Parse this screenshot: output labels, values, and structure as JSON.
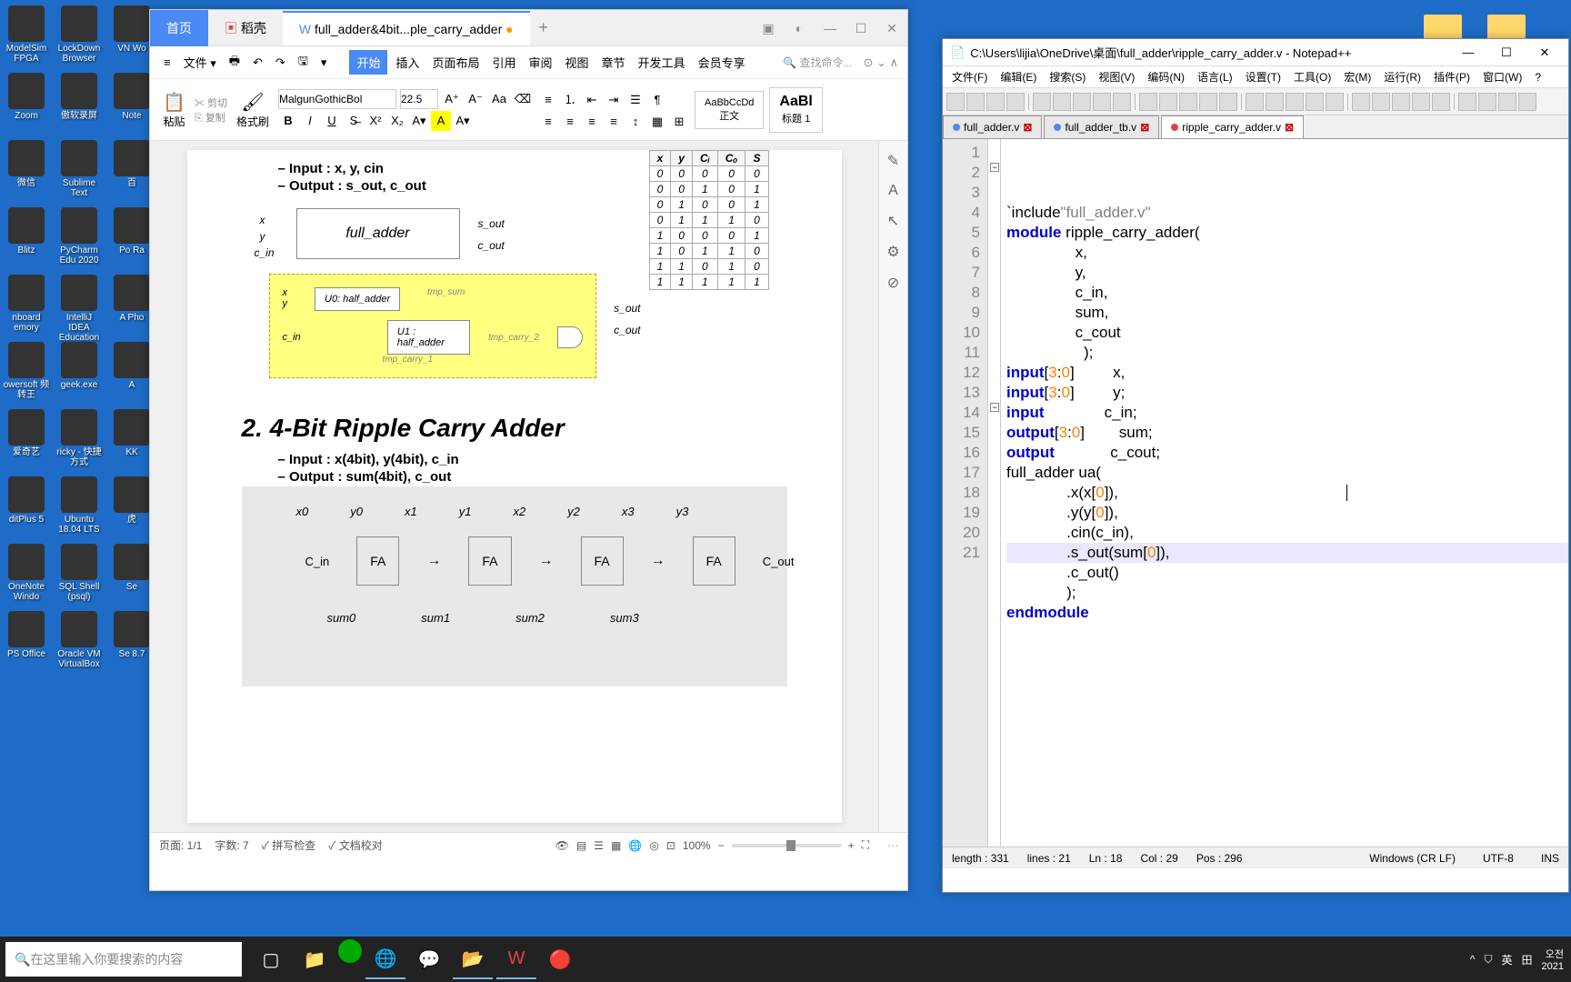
{
  "desktop_icons": [
    [
      "ModelSim FPGA",
      "LockDown Browser",
      "VN Wo"
    ],
    [
      "Zoom",
      "傲软录屏",
      "Note"
    ],
    [
      "微信",
      "Sublime Text",
      "百"
    ],
    [
      "Blitz",
      "PyCharm Edu 2020",
      "Po Ra"
    ],
    [
      "nboard emory",
      "IntelliJ IDEA Education",
      "A Pho"
    ],
    [
      "owersoft 频转王",
      "geek.exe",
      "A"
    ],
    [
      "爱奇艺",
      "ricky - 快捷方式",
      "KK"
    ],
    [
      "ditPlus 5",
      "Ubuntu 18.04 LTS",
      "虎"
    ],
    [
      "OneNote Windo",
      "SQL Shell (psql)",
      "Se"
    ],
    [
      "PS Office",
      "Oracle VM VirtualBox",
      "Se 8.7"
    ]
  ],
  "wps": {
    "tabs": {
      "home": "首页",
      "shell": "稻壳",
      "doc": "full_adder&4bit...ple_carry_adder"
    },
    "menu": [
      "三",
      "文件",
      "▢",
      "↶",
      "↷",
      "⎙",
      "⌄",
      "▾"
    ],
    "menubar": [
      "开始",
      "插入",
      "页面布局",
      "引用",
      "审阅",
      "视图",
      "章节",
      "开发工具",
      "会员专享"
    ],
    "search_ph": "查找命令...",
    "ribbon": {
      "paste": "粘贴",
      "cut": "剪切",
      "copy": "复制",
      "fmt": "格式刷",
      "font": "MalgunGothicBol",
      "size": "22.5",
      "style1": "AaBbCcDd",
      "style1_name": "正文",
      "style2": "AaBl",
      "style2_name": "标题 1"
    },
    "doc": {
      "bullets1": [
        "Input : x, y, cin",
        "Output : s_out, c_out"
      ],
      "fa_block": "full_adder",
      "sig_in": [
        "x",
        "y",
        "c_in"
      ],
      "sig_out": [
        "s_out",
        "c_out"
      ],
      "ha": [
        "U0:\nhalf_adder",
        "U1 :\nhalf_adder"
      ],
      "ha_nets": [
        "tmp_sum",
        "tmp_carry_2",
        "tmp_carry_1"
      ],
      "truth_hdr": [
        "x",
        "y",
        "Cᵢ",
        "Cₒ",
        "S"
      ],
      "truth_rows": [
        [
          "0",
          "0",
          "0",
          "0",
          "0"
        ],
        [
          "0",
          "0",
          "1",
          "0",
          "1"
        ],
        [
          "0",
          "1",
          "0",
          "0",
          "1"
        ],
        [
          "0",
          "1",
          "1",
          "1",
          "0"
        ],
        [
          "1",
          "0",
          "0",
          "0",
          "1"
        ],
        [
          "1",
          "0",
          "1",
          "1",
          "0"
        ],
        [
          "1",
          "1",
          "0",
          "1",
          "0"
        ],
        [
          "1",
          "1",
          "1",
          "1",
          "1"
        ]
      ],
      "h2": "2. 4-Bit Ripple Carry Adder",
      "bullets2": [
        "Input : x(4bit), y(4bit), c_in",
        "Output : sum(4bit), c_out"
      ],
      "fa4": {
        "in": [
          "x0",
          "y0",
          "x1",
          "y1",
          "x2",
          "y2",
          "x3",
          "y3"
        ],
        "cin": "C_in",
        "cout": "C_out",
        "out": [
          "sum0",
          "sum1",
          "sum2",
          "sum3"
        ],
        "label": "FA"
      }
    },
    "status": {
      "page": "页面: 1/1",
      "words": "字数: 7",
      "spell": "拼写检查",
      "proof": "文档校对",
      "zoom": "100%"
    }
  },
  "npp": {
    "title": "C:\\Users\\lijia\\OneDrive\\桌面\\full_adder\\ripple_carry_adder.v - Notepad++",
    "menu": [
      "文件(F)",
      "编辑(E)",
      "搜索(S)",
      "视图(V)",
      "编码(N)",
      "语言(L)",
      "设置(T)",
      "工具(O)",
      "宏(M)",
      "运行(R)",
      "插件(P)",
      "窗口(W)",
      "?"
    ],
    "tabs": [
      {
        "name": "full_adder.v",
        "mod": false
      },
      {
        "name": "full_adder_tb.v",
        "mod": false
      },
      {
        "name": "ripple_carry_adder.v",
        "mod": true,
        "active": true
      }
    ],
    "code": [
      {
        "n": 1,
        "t": "`include\"full_adder.v\""
      },
      {
        "n": 2,
        "t": "module ripple_carry_adder("
      },
      {
        "n": 3,
        "t": "                x,"
      },
      {
        "n": 4,
        "t": "                y,"
      },
      {
        "n": 5,
        "t": "                c_in,"
      },
      {
        "n": 6,
        "t": "                sum,"
      },
      {
        "n": 7,
        "t": "                c_cout"
      },
      {
        "n": 8,
        "t": "                  );"
      },
      {
        "n": 9,
        "t": "input[3:0]         x,"
      },
      {
        "n": 10,
        "t": "input[3:0]         y;"
      },
      {
        "n": 11,
        "t": "input              c_in;"
      },
      {
        "n": 12,
        "t": "output[3:0]        sum;"
      },
      {
        "n": 13,
        "t": "output             c_cout;"
      },
      {
        "n": 14,
        "t": "full_adder ua("
      },
      {
        "n": 15,
        "t": "              .x(x[0]),"
      },
      {
        "n": 16,
        "t": "              .y(y[0]),"
      },
      {
        "n": 17,
        "t": "              .cin(c_in),"
      },
      {
        "n": 18,
        "t": "              .s_out(sum[0]),"
      },
      {
        "n": 19,
        "t": "              .c_out()"
      },
      {
        "n": 20,
        "t": "              );"
      },
      {
        "n": 21,
        "t": "endmodule"
      }
    ],
    "status": {
      "len": "length : 331",
      "lines": "lines : 21",
      "ln": "Ln : 18",
      "col": "Col : 29",
      "pos": "Pos : 296",
      "eol": "Windows (CR LF)",
      "enc": "UTF-8",
      "mode": "INS"
    }
  },
  "taskbar": {
    "search_ph": "在这里输入你要搜索的内容",
    "tray": [
      "^",
      "⛉",
      "英",
      "田"
    ],
    "time": "오전",
    "date": "2021"
  }
}
